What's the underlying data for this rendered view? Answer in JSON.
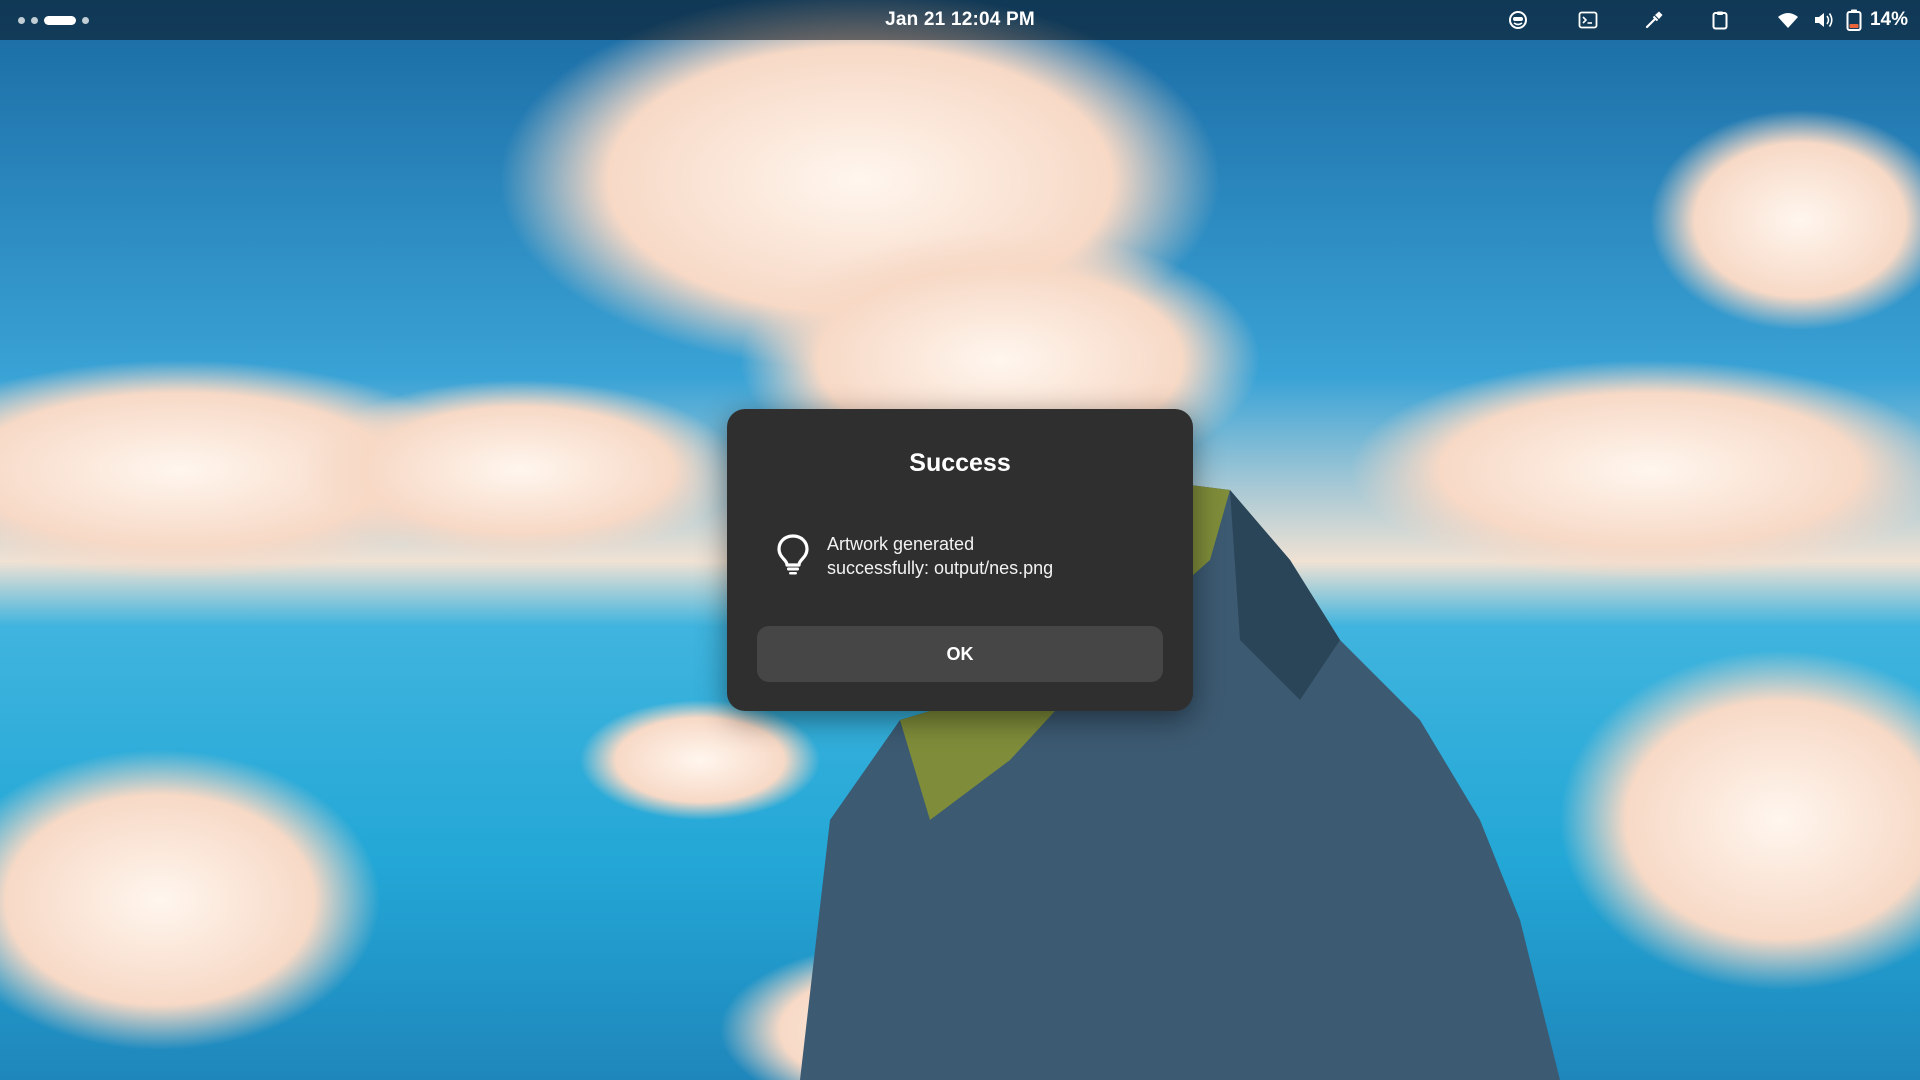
{
  "topbar": {
    "clock": "Jan 21  12:04 PM",
    "tray_icons": [
      "face-icon",
      "terminal-icon",
      "color-picker-icon",
      "clipboard-icon",
      "wifi-icon",
      "volume-icon",
      "battery-icon"
    ],
    "battery_percent": "14%"
  },
  "dialog": {
    "title": "Success",
    "icon": "lightbulb-icon",
    "message_line1": "Artwork generated",
    "message_line2": "successfully: output/nes.png",
    "ok_label": "OK"
  },
  "colors": {
    "dialog_bg": "#2f2f2f",
    "button_bg": "#464646",
    "battery_warning": "#e8643a"
  }
}
